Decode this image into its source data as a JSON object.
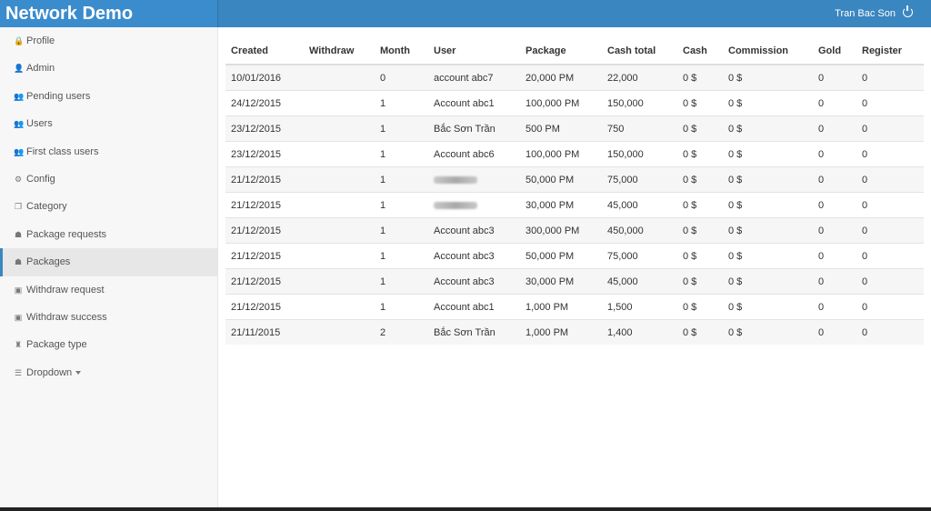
{
  "app": {
    "title": "Network Demo",
    "user_name": "Tran Bac Son"
  },
  "sidebar": {
    "items": [
      {
        "label": "Profile",
        "icon": "lock-icon",
        "glyph": "🔒"
      },
      {
        "label": "Admin",
        "icon": "user-icon",
        "glyph": "👤"
      },
      {
        "label": "Pending users",
        "icon": "users-icon",
        "glyph": "👥"
      },
      {
        "label": "Users",
        "icon": "users-icon",
        "glyph": "👥"
      },
      {
        "label": "First class users",
        "icon": "users-icon",
        "glyph": "👥"
      },
      {
        "label": "Config",
        "icon": "gears-icon",
        "glyph": "⚙"
      },
      {
        "label": "Category",
        "icon": "copy-icon",
        "glyph": "❐"
      },
      {
        "label": "Package requests",
        "icon": "sitemap-icon",
        "glyph": "☗"
      },
      {
        "label": "Packages",
        "icon": "sitemap-icon",
        "glyph": "☗",
        "active": true
      },
      {
        "label": "Withdraw request",
        "icon": "money-icon",
        "glyph": "▣"
      },
      {
        "label": "Withdraw success",
        "icon": "money-icon",
        "glyph": "▣"
      },
      {
        "label": "Package type",
        "icon": "trophy-icon",
        "glyph": "♜"
      },
      {
        "label": "Dropdown",
        "icon": "list-icon",
        "glyph": "☰",
        "dropdown": true
      }
    ]
  },
  "table": {
    "headers": [
      "Created",
      "Withdraw",
      "Month",
      "User",
      "Package",
      "Cash total",
      "Cash",
      "Commission",
      "Gold",
      "Register"
    ],
    "rows": [
      [
        "10/01/2016",
        "",
        "0",
        "account abc7",
        "20,000 PM",
        "22,000",
        "0 $",
        "0 $",
        "0",
        "0"
      ],
      [
        "24/12/2015",
        "",
        "1",
        "Account abc1",
        "100,000 PM",
        "150,000",
        "0 $",
        "0 $",
        "0",
        "0"
      ],
      [
        "23/12/2015",
        "",
        "1",
        "Bắc Sơn Trần",
        "500 PM",
        "750",
        "0 $",
        "0 $",
        "0",
        "0"
      ],
      [
        "23/12/2015",
        "",
        "1",
        "Account abc6",
        "100,000 PM",
        "150,000",
        "0 $",
        "0 $",
        "0",
        "0"
      ],
      [
        "21/12/2015",
        "",
        "1",
        "",
        "50,000 PM",
        "75,000",
        "0 $",
        "0 $",
        "0",
        "0"
      ],
      [
        "21/12/2015",
        "",
        "1",
        "",
        "30,000 PM",
        "45,000",
        "0 $",
        "0 $",
        "0",
        "0"
      ],
      [
        "21/12/2015",
        "",
        "1",
        "Account abc3",
        "300,000 PM",
        "450,000",
        "0 $",
        "0 $",
        "0",
        "0"
      ],
      [
        "21/12/2015",
        "",
        "1",
        "Account abc3",
        "50,000 PM",
        "75,000",
        "0 $",
        "0 $",
        "0",
        "0"
      ],
      [
        "21/12/2015",
        "",
        "1",
        "Account abc3",
        "30,000 PM",
        "45,000",
        "0 $",
        "0 $",
        "0",
        "0"
      ],
      [
        "21/12/2015",
        "",
        "1",
        "Account abc1",
        "1,000 PM",
        "1,500",
        "0 $",
        "0 $",
        "0",
        "0"
      ],
      [
        "21/11/2015",
        "",
        "2",
        "Bắc Sơn Trần",
        "1,000 PM",
        "1,400",
        "0 $",
        "0 $",
        "0",
        "0"
      ]
    ],
    "blurred_user_rows": [
      4,
      5
    ]
  },
  "colors": {
    "topbar": "#3a86c0",
    "brand": "#3b8ccc",
    "sidebar_bg": "#f7f7f7",
    "active_bg": "#e7e7e7"
  }
}
